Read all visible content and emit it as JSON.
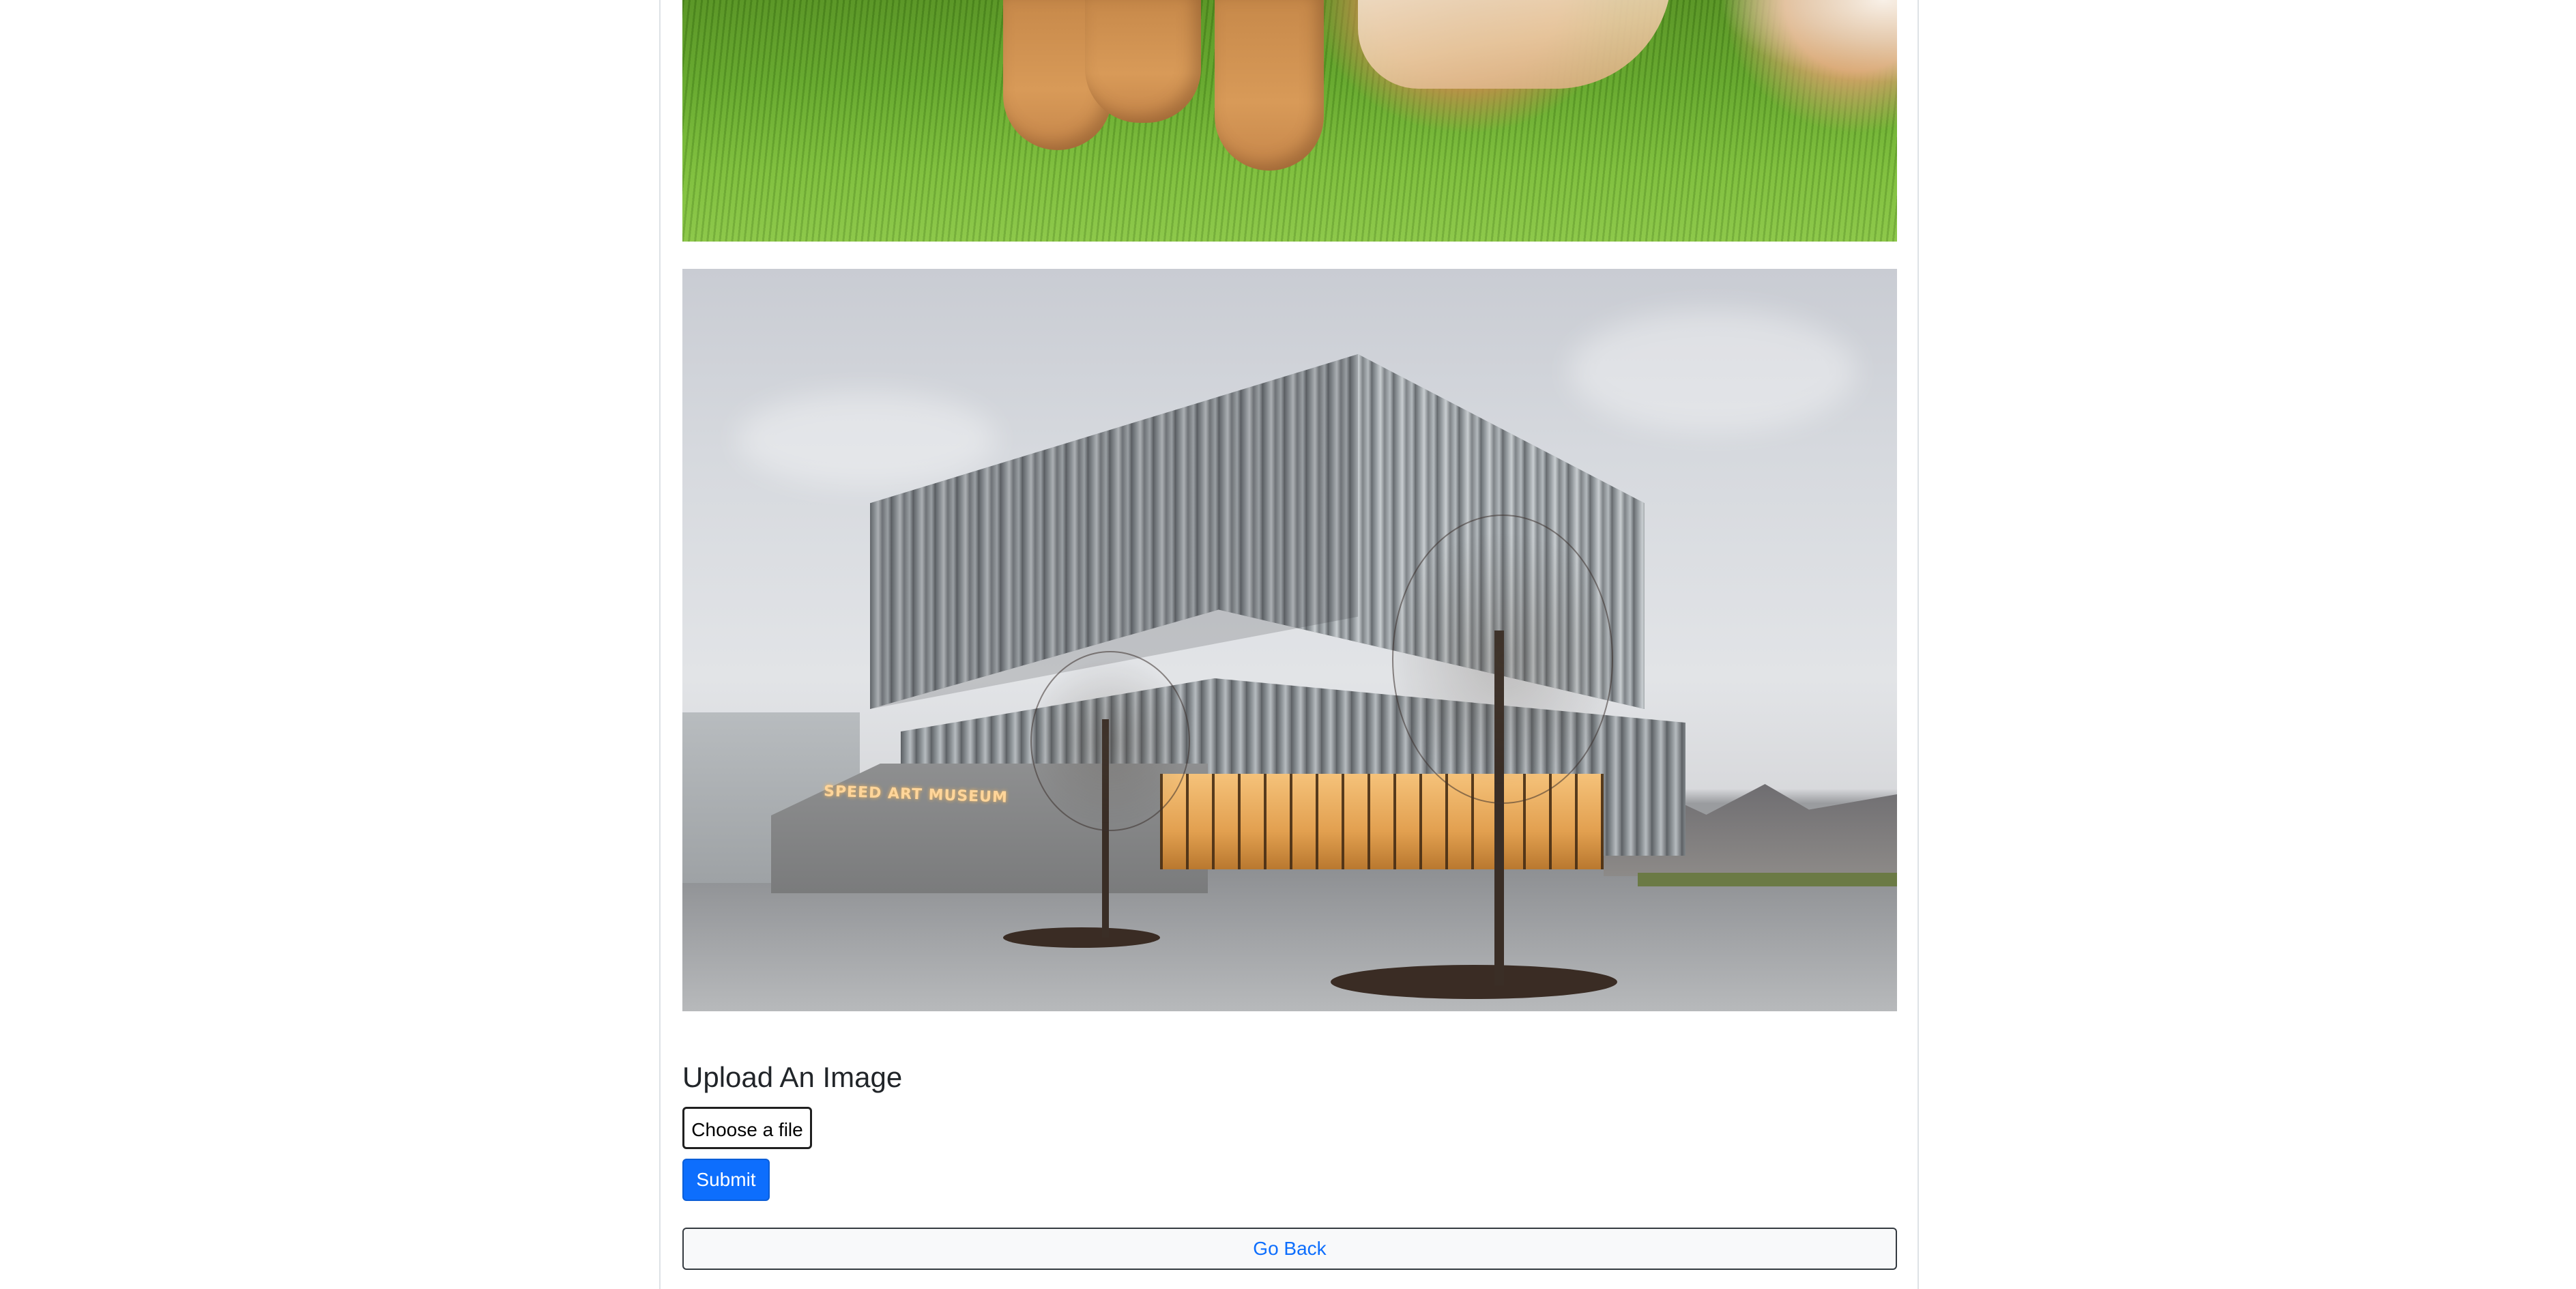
{
  "gallery": {
    "images": [
      {
        "alt": "dog-on-grass"
      },
      {
        "alt": "museum-building",
        "sign": "SPEED ART MUSEUM"
      }
    ]
  },
  "upload": {
    "title": "Upload An Image",
    "choose_file_label": "Choose a file",
    "submit_label": "Submit"
  },
  "nav": {
    "back_label": "Go Back"
  },
  "colors": {
    "primary": "#0d6efd",
    "text": "#212529",
    "light_bg": "#f8f9fa",
    "border": "#dee2e6"
  }
}
